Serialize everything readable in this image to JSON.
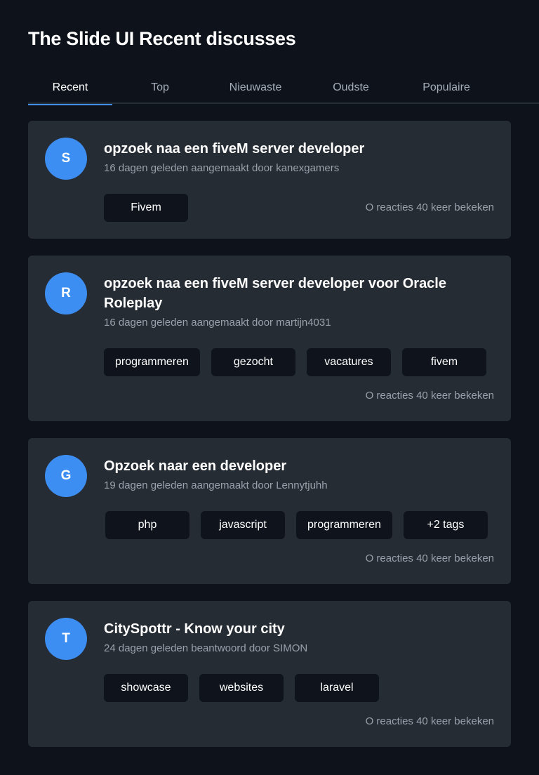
{
  "header": {
    "title": "The Slide UI Recent discusses"
  },
  "tabs": [
    {
      "label": "Recent",
      "active": true
    },
    {
      "label": "Top",
      "active": false
    },
    {
      "label": "Nieuwaste",
      "active": false
    },
    {
      "label": "Oudste",
      "active": false
    },
    {
      "label": "Populaire",
      "active": false
    }
  ],
  "colors": {
    "background": "#0e131b",
    "card": "#262c33",
    "accent": "#3f8fe8",
    "avatar": "#3d8ef2",
    "tag": "#0f141c",
    "muted_text": "#9aa1ab"
  },
  "discussions": [
    {
      "avatar": "S",
      "title": "opzoek naa een fiveM server developer",
      "meta": "16 dagen geleden aangemaakt door kanexgamers",
      "tags": [
        "Fivem"
      ],
      "stats": "O reacties 40 keer bekeken"
    },
    {
      "avatar": "R",
      "title": "opzoek naa een fiveM server developer voor Oracle Roleplay",
      "meta": "16 dagen geleden aangemaakt door martijn4031",
      "tags": [
        "programmeren",
        "gezocht",
        "vacatures",
        "fivem"
      ],
      "stats": "O reacties 40 keer bekeken"
    },
    {
      "avatar": "G",
      "title": "Opzoek naar een developer",
      "meta": "19 dagen geleden aangemaakt door Lennytjuhh",
      "tags": [
        "php",
        "javascript",
        "programmeren",
        "+2 tags"
      ],
      "stats": "O reacties 40 keer bekeken"
    },
    {
      "avatar": "T",
      "title": "CitySpottr - Know your city",
      "meta": "24 dagen geleden beantwoord door SIMON",
      "tags": [
        "showcase",
        "websites",
        "laravel"
      ],
      "stats": "O reacties 40 keer bekeken"
    }
  ]
}
